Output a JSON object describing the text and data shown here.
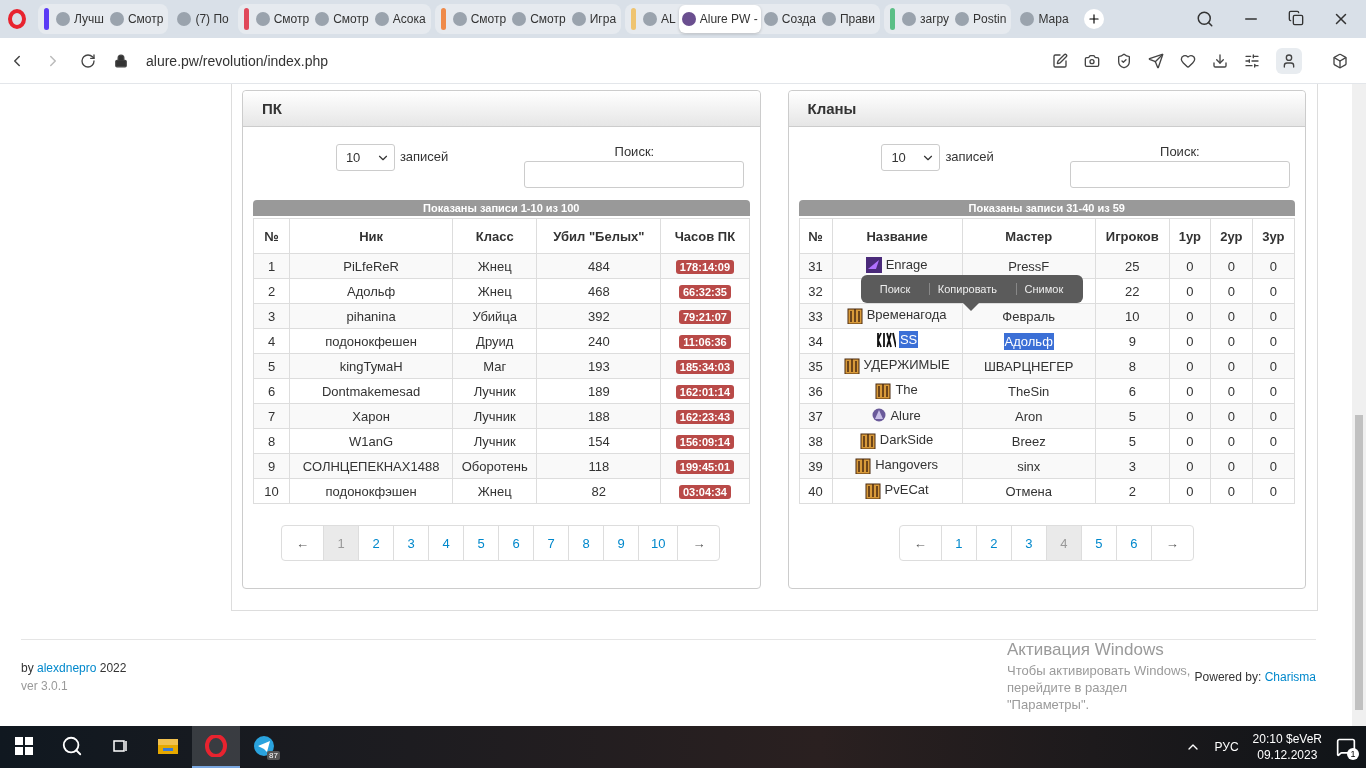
{
  "browser": {
    "tab_groups": [
      {
        "color": "#5b3bf5",
        "tabs": [
          {
            "title": "Лучш",
            "selected": false
          },
          {
            "title": "Смотр",
            "selected": false
          }
        ]
      },
      {
        "tabs": [
          {
            "title": "(7) По",
            "selected": false
          }
        ]
      },
      {
        "color": "#e0485a",
        "tabs": [
          {
            "title": "Смотр",
            "selected": false
          },
          {
            "title": "Смотр",
            "selected": false
          },
          {
            "title": "Асока",
            "selected": false
          }
        ]
      },
      {
        "color": "#ef8a4a",
        "tabs": [
          {
            "title": "Смотр",
            "selected": false
          },
          {
            "title": "Смотр",
            "selected": false
          },
          {
            "title": "Игра",
            "selected": false
          }
        ]
      },
      {
        "color": "#efc470",
        "tabs": [
          {
            "title": "AL",
            "selected": false
          },
          {
            "title": "Alure PW -",
            "selected": true
          },
          {
            "title": "Созда",
            "selected": false
          },
          {
            "title": "Прави",
            "selected": false
          }
        ]
      },
      {
        "color": "#5bbf86",
        "tabs": [
          {
            "title": "загру",
            "selected": false
          },
          {
            "title": "Postin",
            "selected": false
          }
        ]
      },
      {
        "tabs": [
          {
            "title": "Мара",
            "selected": false
          }
        ]
      }
    ],
    "url": "alure.pw/revolution/index.php"
  },
  "pk_panel": {
    "title": "ПК",
    "length_value": "10",
    "length_label": "записей",
    "search_label": "Поиск:",
    "info": "Показаны записи 1-10 из 100",
    "columns": [
      "№",
      "Ник",
      "Класс",
      "Убил \"Белых\"",
      "Часов ПК"
    ],
    "rows": [
      {
        "n": "1",
        "nick": "PiLfeReR",
        "class": "Жнец",
        "kills": "484",
        "hours": "178:14:09"
      },
      {
        "n": "2",
        "nick": "Адольф",
        "class": "Жнец",
        "kills": "468",
        "hours": "66:32:35"
      },
      {
        "n": "3",
        "nick": "pihanina",
        "class": "Убийца",
        "kills": "392",
        "hours": "79:21:07"
      },
      {
        "n": "4",
        "nick": "подонокфешен",
        "class": "Друид",
        "kills": "240",
        "hours": "11:06:36"
      },
      {
        "n": "5",
        "nick": "kingТумаН",
        "class": "Маг",
        "kills": "193",
        "hours": "185:34:03"
      },
      {
        "n": "6",
        "nick": "Dontmakemesad",
        "class": "Лучник",
        "kills": "189",
        "hours": "162:01:14"
      },
      {
        "n": "7",
        "nick": "Харон",
        "class": "Лучник",
        "kills": "188",
        "hours": "162:23:43"
      },
      {
        "n": "8",
        "nick": "W1anG",
        "class": "Лучник",
        "kills": "154",
        "hours": "156:09:14"
      },
      {
        "n": "9",
        "nick": "СОЛНЦЕПЕКНАХ1488",
        "class": "Оборотень",
        "kills": "118",
        "hours": "199:45:01"
      },
      {
        "n": "10",
        "nick": "подонокфэшен",
        "class": "Жнец",
        "kills": "82",
        "hours": "03:04:34"
      }
    ],
    "pages": [
      {
        "label": "←",
        "selected": false
      },
      {
        "label": "1",
        "selected": true
      },
      {
        "label": "2",
        "selected": false
      },
      {
        "label": "3",
        "selected": false
      },
      {
        "label": "4",
        "selected": false
      },
      {
        "label": "5",
        "selected": false
      },
      {
        "label": "6",
        "selected": false
      },
      {
        "label": "7",
        "selected": false
      },
      {
        "label": "8",
        "selected": false
      },
      {
        "label": "9",
        "selected": false
      },
      {
        "label": "10",
        "selected": false
      },
      {
        "label": "→",
        "selected": false
      }
    ]
  },
  "clans_panel": {
    "title": "Кланы",
    "length_value": "10",
    "length_label": "записей",
    "search_label": "Поиск:",
    "info": "Показаны записи 31-40 из 59",
    "columns": [
      "№",
      "Название",
      "Мастер",
      "Игроков",
      "1ур",
      "2ур",
      "3ур"
    ],
    "rows": [
      {
        "n": "31",
        "kind": "enrage",
        "name": "Enrage",
        "master": "PressF",
        "players": "25",
        "l1": "0",
        "l2": "0",
        "l3": "0",
        "highlighted": false
      },
      {
        "n": "32",
        "kind": "faded",
        "players": "22",
        "l1": "0",
        "l2": "0",
        "l3": "0",
        "highlighted": false
      },
      {
        "n": "33",
        "kind": "banner",
        "name": "Временагода",
        "master": "Февраль",
        "players": "10",
        "l1": "0",
        "l2": "0",
        "l3": "0",
        "highlighted": false
      },
      {
        "n": "34",
        "kind": "stripes",
        "name": "SS",
        "master": "Адольф",
        "players": "9",
        "l1": "0",
        "l2": "0",
        "l3": "0",
        "highlighted": true
      },
      {
        "n": "35",
        "kind": "banner",
        "name": "УДЕРЖИМЫЕ",
        "master": "ШВАРЦНЕГЕР",
        "players": "8",
        "l1": "0",
        "l2": "0",
        "l3": "0",
        "highlighted": false
      },
      {
        "n": "36",
        "kind": "banner",
        "name": "The",
        "master": "TheSin",
        "players": "6",
        "l1": "0",
        "l2": "0",
        "l3": "0",
        "highlighted": false
      },
      {
        "n": "37",
        "kind": "gem",
        "name": "Alure",
        "master": "Aron",
        "players": "5",
        "l1": "0",
        "l2": "0",
        "l3": "0",
        "highlighted": false
      },
      {
        "n": "38",
        "kind": "banner",
        "name": "DarkSide",
        "master": "Breez",
        "players": "5",
        "l1": "0",
        "l2": "0",
        "l3": "0",
        "highlighted": false
      },
      {
        "n": "39",
        "kind": "banner",
        "name": "Hangovers",
        "master": "sinx",
        "players": "3",
        "l1": "0",
        "l2": "0",
        "l3": "0",
        "highlighted": false
      },
      {
        "n": "40",
        "kind": "banner",
        "name": "PvECat",
        "master": "Отмена",
        "players": "2",
        "l1": "0",
        "l2": "0",
        "l3": "0",
        "highlighted": false
      }
    ],
    "context_menu": [
      "Поиск",
      "Копировать",
      "Снимок"
    ],
    "pages": [
      {
        "label": "←",
        "selected": false
      },
      {
        "label": "1",
        "selected": false
      },
      {
        "label": "2",
        "selected": false
      },
      {
        "label": "3",
        "selected": false
      },
      {
        "label": "4",
        "selected": true
      },
      {
        "label": "5",
        "selected": false
      },
      {
        "label": "6",
        "selected": false
      },
      {
        "label": "→",
        "selected": false
      }
    ]
  },
  "footer": {
    "credit_prefix": "by",
    "credit_link": "alexdnepro",
    "credit_suffix": "2022",
    "version": "ver 3.0.1",
    "powered_label": "Powered by:",
    "powered_link": "Charisma"
  },
  "activation": {
    "title": "Активация Windows",
    "text": "Чтобы активировать Windows, перейдите в раздел \"Параметры\"."
  },
  "taskbar": {
    "apps": [
      {
        "kind": "folder",
        "active": false
      },
      {
        "kind": "opera",
        "active": true
      },
      {
        "kind": "telegram",
        "active": false,
        "badge": "87"
      }
    ],
    "language": "РУС",
    "time": "20:10 $eVeR",
    "date": "09.12.2023",
    "notifications": "1"
  }
}
